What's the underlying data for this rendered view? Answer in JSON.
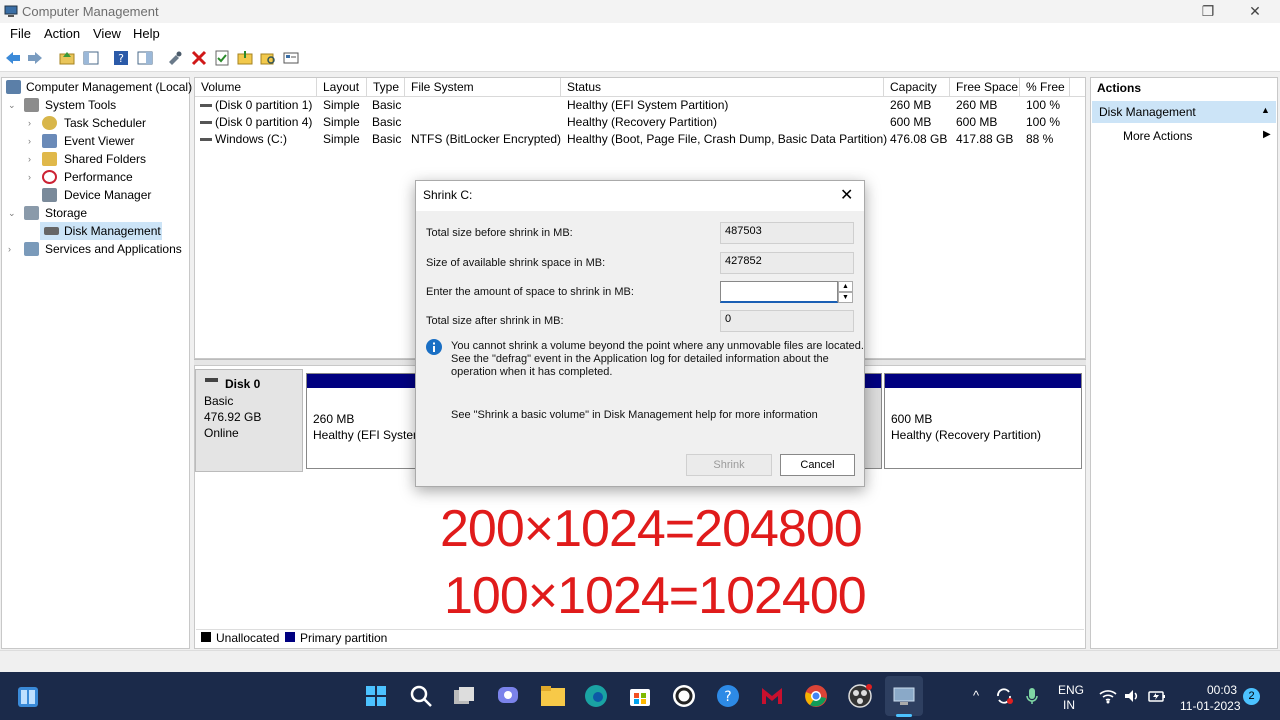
{
  "window": {
    "title": "Computer Management"
  },
  "menu": [
    "File",
    "Action",
    "View",
    "Help"
  ],
  "tree": {
    "root": "Computer Management (Local)",
    "items": [
      {
        "label": "System Tools",
        "level": 1,
        "expanded": true,
        "icon": "tools-icon"
      },
      {
        "label": "Task Scheduler",
        "level": 2,
        "icon": "clock-icon"
      },
      {
        "label": "Event Viewer",
        "level": 2,
        "icon": "event-viewer-icon"
      },
      {
        "label": "Shared Folders",
        "level": 2,
        "icon": "shared-folder-icon"
      },
      {
        "label": "Performance",
        "level": 2,
        "icon": "performance-icon"
      },
      {
        "label": "Device Manager",
        "level": 2,
        "icon": "device-manager-icon"
      },
      {
        "label": "Storage",
        "level": 1,
        "expanded": true,
        "icon": "storage-icon"
      },
      {
        "label": "Disk Management",
        "level": 2,
        "selected": true,
        "icon": "disk-icon"
      },
      {
        "label": "Services and Applications",
        "level": 1,
        "icon": "services-icon"
      }
    ]
  },
  "volumes": {
    "columns": [
      "Volume",
      "Layout",
      "Type",
      "File System",
      "Status",
      "Capacity",
      "Free Space",
      "% Free"
    ],
    "rows": [
      [
        "(Disk 0 partition 1)",
        "Simple",
        "Basic",
        "",
        "Healthy (EFI System Partition)",
        "260 MB",
        "260 MB",
        "100 %"
      ],
      [
        "(Disk 0 partition 4)",
        "Simple",
        "Basic",
        "",
        "Healthy (Recovery Partition)",
        "600 MB",
        "600 MB",
        "100 %"
      ],
      [
        "Windows (C:)",
        "Simple",
        "Basic",
        "NTFS (BitLocker Encrypted)",
        "Healthy (Boot, Page File, Crash Dump, Basic Data Partition)",
        "476.08 GB",
        "417.88 GB",
        "88 %"
      ]
    ]
  },
  "disk": {
    "name": "Disk 0",
    "type": "Basic",
    "size": "476.92 GB",
    "state": "Online",
    "p1_size": "260 MB",
    "p1_status": "Healthy (EFI System",
    "p2_size": "600 MB",
    "p2_status": "Healthy (Recovery Partition)"
  },
  "legend": {
    "unallocated": "Unallocated",
    "primary": "Primary partition"
  },
  "actions": {
    "title": "Actions",
    "section": "Disk Management",
    "more": "More Actions"
  },
  "dialog": {
    "title": "Shrink C:",
    "total_before_label": "Total size before shrink in MB:",
    "total_before_value": "487503",
    "available_label": "Size of available shrink space in MB:",
    "available_value": "427852",
    "amount_label": "Enter the amount of space to shrink in MB:",
    "amount_value": "",
    "after_label": "Total size after shrink in MB:",
    "after_value": "0",
    "info_line1": "You cannot shrink a volume beyond the point where any unmovable files are located.",
    "info_line2": "See the \"defrag\" event in the Application log for detailed information about the",
    "info_line3": "operation when it has completed.",
    "help_text": "See \"Shrink a basic volume\" in Disk Management help for more information",
    "shrink_button": "Shrink",
    "cancel_button": "Cancel"
  },
  "annotations": [
    "200×1024=204800",
    "100×1024=102400"
  ],
  "taskbar": {
    "lang1": "ENG",
    "lang2": "IN",
    "time": "00:03",
    "date": "11-01-2023",
    "notifications": "2"
  },
  "colors": {
    "primary_partition": "#000080",
    "annotation": "#e01b1b",
    "selection": "#cce4f7",
    "taskbar": "#1b2a4a"
  }
}
